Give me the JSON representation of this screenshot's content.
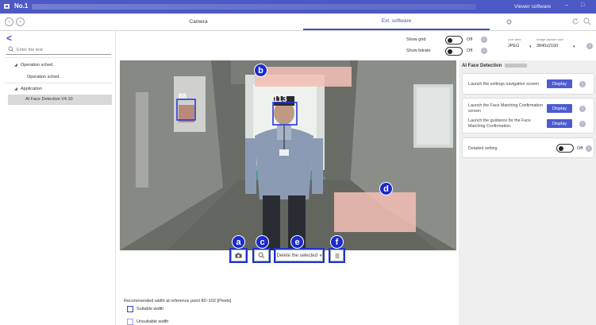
{
  "titlebar": {
    "title": "No.1",
    "right_title": "Viewer software",
    "min_btn": "–",
    "max_btn": "□"
  },
  "topnav": {
    "back": "‹",
    "forward": "›",
    "tab_camera": "Camera",
    "tab_ext": "Ext. software"
  },
  "leftpanel": {
    "search": {
      "placeholder": "Enter the text"
    },
    "tree": [
      {
        "label": "Operation sched."
      },
      {
        "label": "Operation sched."
      },
      {
        "label": "Application"
      },
      {
        "label": "AI Face Detection V4.10"
      }
    ]
  },
  "toggles": {
    "show_grid": {
      "label": "Show grid",
      "state": "Off"
    },
    "show_bitrate": {
      "label": "Show bitrate",
      "state": "Off"
    }
  },
  "liveview": {
    "live_view_label": "Live view",
    "live_view_value": "JPEG",
    "capture_label": "Image capture size",
    "capture_value": "3840x2160"
  },
  "camera": {
    "overlay_left_num": "88",
    "overlay_center_num": "113"
  },
  "controls": {
    "delete_selected": "Delete the selected"
  },
  "badges": {
    "a": "a",
    "b": "b",
    "c": "c",
    "d": "d",
    "e": "e",
    "f": "f"
  },
  "bottom": {
    "recommended": "Recommended width at reference point   80~102 [Pixels]",
    "suitable": "Suitable width",
    "unsuitable": "Unsuitable width"
  },
  "rightpanel": {
    "title": "AI Face Detection",
    "card1_text": "Launch the settings navigation screen",
    "card2_text1": "Launch the Face Matching Confirmation screen",
    "card2_text2": "Launch the guidance for the Face Matching Confirmation.",
    "display_label": "Display",
    "detailed_label": "Detailed setting",
    "detailed_state": "Off"
  },
  "colors": {
    "accent": "#4d59c4",
    "badge": "#1a2acb",
    "selection_box": "#2a3ad6",
    "mask": "#f3c0b5"
  }
}
